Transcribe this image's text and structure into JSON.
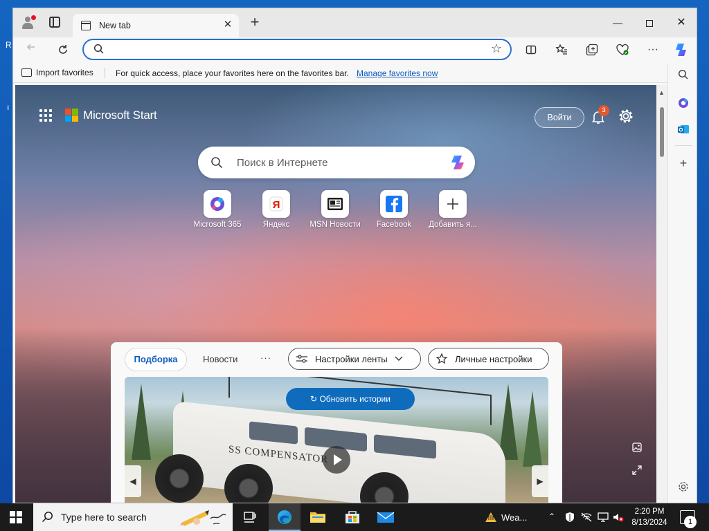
{
  "desktop": {
    "fragment1": "R",
    "fragment2": "ı"
  },
  "browser": {
    "tab_title": "New tab",
    "tab_close": "✕",
    "new_tab": "+",
    "window_min": "—",
    "window_close": "✕",
    "address_value": "",
    "favorites_bar": {
      "import_label": "Import favorites",
      "message": "For quick access, place your favorites here on the favorites bar.",
      "link": "Manage favorites now"
    }
  },
  "page": {
    "brand": "Microsoft Start",
    "login": "Войти",
    "notification_count": "3",
    "search_placeholder": "Поиск в Интернете",
    "quick_links": [
      {
        "label": "Microsoft 365",
        "icon": "microsoft-365-icon"
      },
      {
        "label": "Яндекс",
        "icon": "yandex-icon"
      },
      {
        "label": "MSN Новости",
        "icon": "msn-news-icon"
      },
      {
        "label": "Facebook",
        "icon": "facebook-icon"
      },
      {
        "label": "Добавить я...",
        "icon": "add-icon"
      }
    ],
    "feed": {
      "tab_active": "Подборка",
      "tab_news": "Новости",
      "tab_more": "···",
      "feed_settings": "Настройки ленты",
      "personal_settings": "Личные настройки",
      "refresh_stories": "Обновить истории",
      "story_car_text": "SS COMPENSATOR"
    }
  },
  "taskbar": {
    "search_placeholder": "Type here to search",
    "weather": "Wea...",
    "time": "2:20 PM",
    "date": "8/13/2024",
    "notification_count": "1"
  },
  "colors": {
    "accent": "#0f6cbd",
    "link": "#0f5cc0",
    "notification_badge": "#e15a2d",
    "taskbar": "#1b1b1b"
  }
}
